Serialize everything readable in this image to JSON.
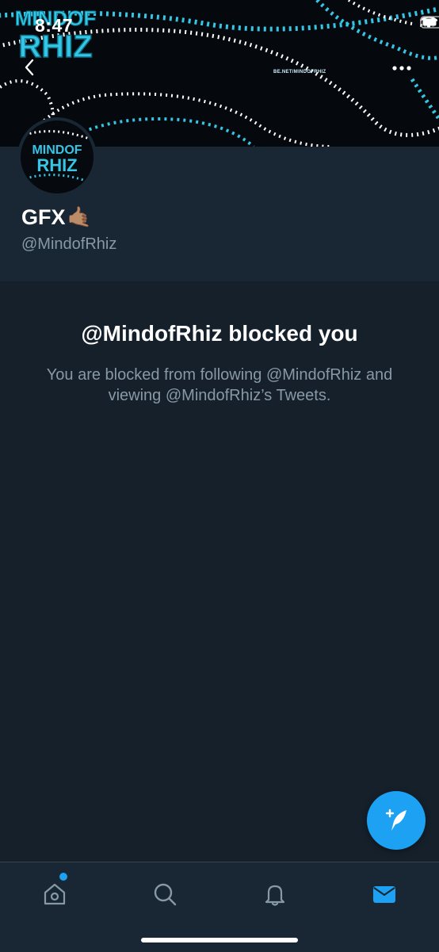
{
  "status_bar": {
    "time": "8:47"
  },
  "banner": {
    "logo_text_line1": "MINDOF",
    "logo_text_line2": "RHIZ",
    "link_text": "BE.NET/MINDOFRHIZ"
  },
  "profile": {
    "display_name": "GFX",
    "display_name_emoji": "🤙🏽",
    "handle": "@MindofRhiz"
  },
  "blocked": {
    "title": "@MindofRhiz blocked you",
    "description": "You are blocked from following @MindofRhiz and viewing @MindofRhiz’s Tweets."
  },
  "nav": {
    "back_icon": "chevron-left-icon",
    "more_icon": "more-horizontal-icon",
    "compose_icon": "compose-tweet-icon",
    "tabs": [
      {
        "name": "home",
        "icon": "home-icon",
        "active": false,
        "has_notification_dot": true
      },
      {
        "name": "search",
        "icon": "search-icon",
        "active": false
      },
      {
        "name": "notifications",
        "icon": "bell-icon",
        "active": false
      },
      {
        "name": "messages",
        "icon": "mail-icon",
        "active": true
      }
    ]
  },
  "colors": {
    "background": "#15202b",
    "header_background": "#192734",
    "accent": "#1da1f2",
    "secondary_text": "#8899a6",
    "banner_cyan": "#35c6e6"
  }
}
